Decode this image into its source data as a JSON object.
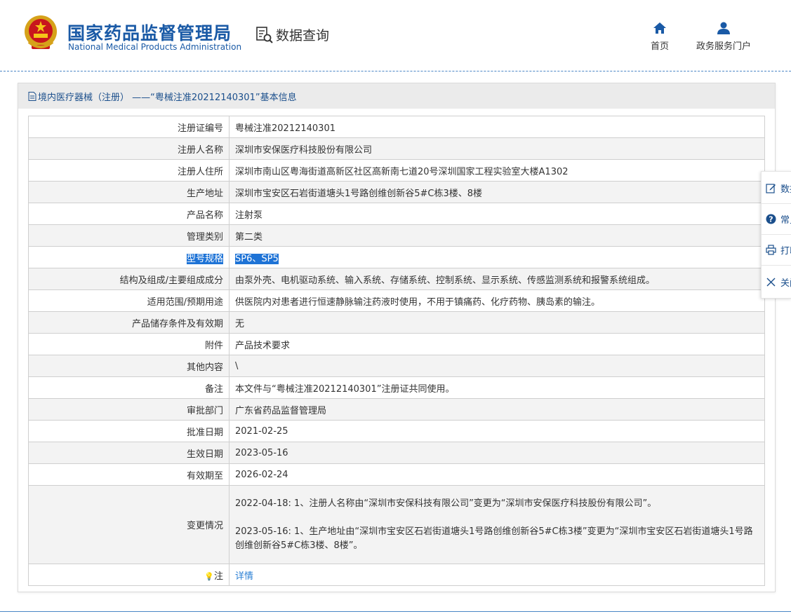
{
  "header": {
    "logo_cn": "国家药品监督管理局",
    "logo_en": "National Medical Products Administration",
    "query_label": "数据查询",
    "nav": [
      {
        "label": "首页",
        "icon": "home-icon"
      },
      {
        "label": "政务服务门户",
        "icon": "user-icon"
      }
    ]
  },
  "panel": {
    "title": "境内医疗器械（注册） ——“粤械注准20212140301”基本信息"
  },
  "fields": [
    {
      "label": "注册证编号",
      "value": "粤械注准20212140301"
    },
    {
      "label": "注册人名称",
      "value": "深圳市安保医疗科技股份有限公司"
    },
    {
      "label": "注册人住所",
      "value": "深圳市南山区粤海街道高新区社区高新南七道20号深圳国家工程实验室大楼A1302"
    },
    {
      "label": "生产地址",
      "value": "深圳市宝安区石岩街道塘头1号路创维创新谷5#C栋3楼、8楼"
    },
    {
      "label": "产品名称",
      "value": "注射泵"
    },
    {
      "label": "管理类别",
      "value": "第二类"
    },
    {
      "label": "型号规格",
      "value": "SP6、SP5"
    },
    {
      "label": "结构及组成/主要组成成分",
      "value": "由泵外壳、电机驱动系统、输入系统、存储系统、控制系统、显示系统、传感监测系统和报警系统组成。"
    },
    {
      "label": "适用范围/预期用途",
      "value": "供医院内对患者进行恒速静脉输注药液时使用，不用于镇痛药、化疗药物、胰岛素的输注。"
    },
    {
      "label": "产品储存条件及有效期",
      "value": "无"
    },
    {
      "label": "附件",
      "value": "产品技术要求"
    },
    {
      "label": "其他内容",
      "value": "\\"
    },
    {
      "label": "备注",
      "value": "本文件与“粤械注准20212140301”注册证共同使用。"
    },
    {
      "label": "审批部门",
      "value": "广东省药品监督管理局"
    },
    {
      "label": "批准日期",
      "value": "2021-02-25"
    },
    {
      "label": "生效日期",
      "value": "2023-05-16"
    },
    {
      "label": "有效期至",
      "value": "2026-02-24"
    }
  ],
  "changes": {
    "label": "变更情况",
    "entries": [
      "2022-04-18: 1、注册人名称由“深圳市安保科技有限公司”变更为“深圳市安保医疗科技股份有限公司”。",
      "2023-05-16: 1、生产地址由“深圳市宝安区石岩街道塘头1号路创维创新谷5#C栋3楼”变更为“深圳市宝安区石岩街道塘头1号路创维创新谷5#C栋3楼、8楼”。"
    ]
  },
  "note": {
    "label": "注",
    "link": "详情"
  },
  "side_toolbar": [
    {
      "label": "数据",
      "icon": "edit-icon"
    },
    {
      "label": "常见",
      "icon": "help-icon"
    },
    {
      "label": "打印",
      "icon": "print-icon"
    },
    {
      "label": "关闭",
      "icon": "close-icon"
    }
  ],
  "colors": {
    "brand_blue": "#1a5aa6",
    "selection_highlight": "#1e73d6",
    "link": "#2a7fd4"
  }
}
